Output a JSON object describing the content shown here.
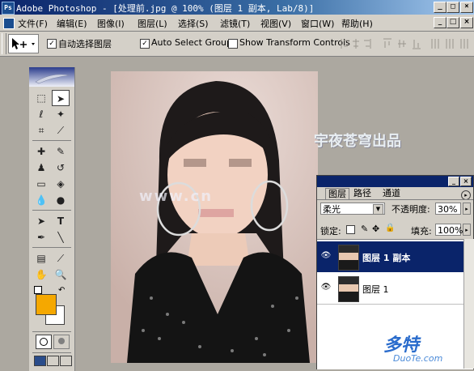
{
  "window": {
    "title": "Adobe Photoshop - [处理前.jpg @ 100% (图层 1 副本, Lab/8)]",
    "controls": [
      "_",
      "□",
      "×"
    ]
  },
  "menu": [
    "文件(F)",
    "编辑(E)",
    "图像(I)",
    "图层(L)",
    "选择(S)",
    "滤镜(T)",
    "视图(V)",
    "窗口(W)",
    "帮助(H)"
  ],
  "options": {
    "auto_select_layer": "自动选择图层",
    "auto_select_groups": "Auto Select Groups",
    "show_transform": "Show Transform Controls"
  },
  "canvas": {
    "watermark": "宇夜苍穹出品",
    "overlay_text": "www.cn"
  },
  "layers_panel": {
    "tabs": [
      "图层",
      "路径",
      "通道"
    ],
    "blend_mode": "柔光",
    "opacity_label": "不透明度:",
    "opacity_value": "30%",
    "lock_label": "锁定:",
    "fill_label": "填充:",
    "fill_value": "100%",
    "layers": [
      {
        "name": "图层 1 副本",
        "selected": true
      },
      {
        "name": "图层 1",
        "selected": false
      }
    ]
  },
  "footer": {
    "brand": "多特",
    "brand_sub": "DuoTe.com"
  },
  "colors": {
    "foreground": "#f5a800",
    "background": "#ffffff",
    "title_bar": "#0a246a",
    "selected_layer": "#0a246a"
  }
}
